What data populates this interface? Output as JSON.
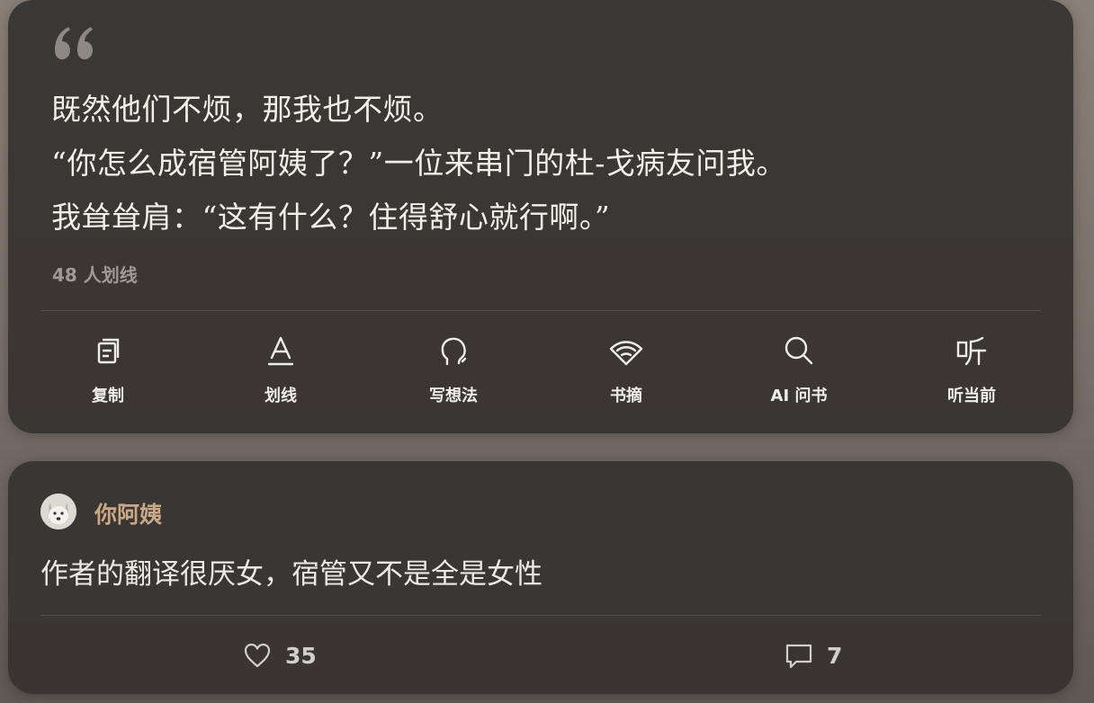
{
  "quote": {
    "lines": [
      "既然他们不烦，那我也不烦。",
      "“你怎么成宿管阿姨了？”一位来串门的杜-戈病友问我。",
      "我耸耸肩：“这有什么？住得舒心就行啊。”"
    ],
    "underline_count": "48 人划线"
  },
  "toolbar": {
    "items": [
      {
        "label": "复制",
        "icon": "copy-icon"
      },
      {
        "label": "划线",
        "icon": "underline-icon"
      },
      {
        "label": "写想法",
        "icon": "thought-icon"
      },
      {
        "label": "书摘",
        "icon": "excerpt-icon"
      },
      {
        "label": "AI 问书",
        "icon": "search-icon"
      },
      {
        "label": "听当前",
        "icon": "listen-icon"
      }
    ]
  },
  "comment": {
    "username": "你阿姨",
    "text": "作者的翻译很厌女，宿管又不是全是女性",
    "like_count": "35",
    "reply_count": "7",
    "avatar": "dog-avatar"
  },
  "colors": {
    "card_bg": "#383432",
    "username": "#c9a888",
    "text": "#f2efe9"
  }
}
